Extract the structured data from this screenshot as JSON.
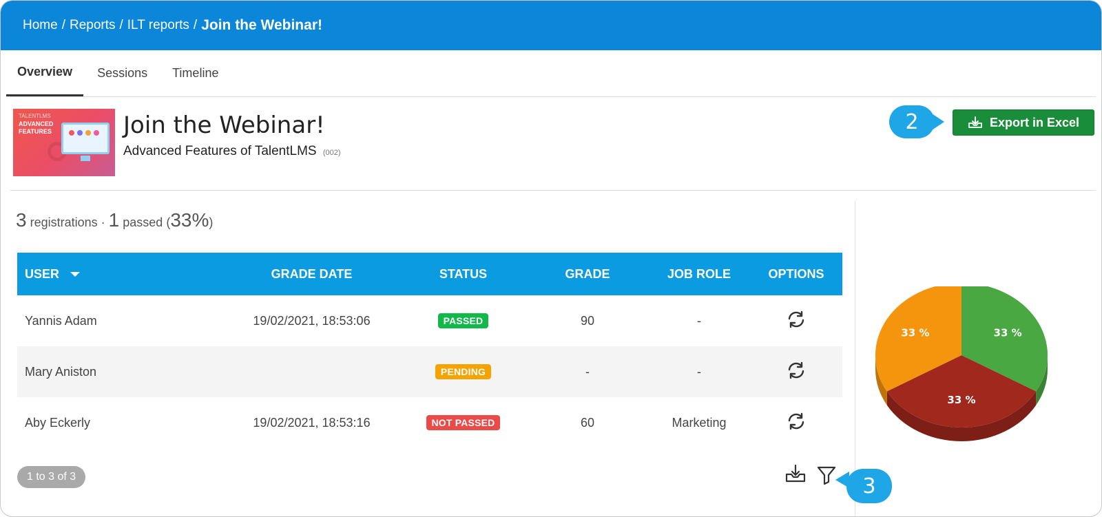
{
  "breadcrumb": {
    "items": [
      "Home",
      "Reports",
      "ILT reports"
    ],
    "separator": "/",
    "current": "Join the Webinar!"
  },
  "tabs": [
    {
      "label": "Overview",
      "active": true
    },
    {
      "label": "Sessions",
      "active": false
    },
    {
      "label": "Timeline",
      "active": false
    }
  ],
  "course": {
    "thumbnail": {
      "brand": "TALENTLMS",
      "line1": "ADVANCED",
      "line2": "FEATURES"
    },
    "title": "Join the Webinar!",
    "subtitle": "Advanced Features of TalentLMS",
    "code": "(002)"
  },
  "export": {
    "label": "Export in Excel",
    "icon": "download-tray-icon"
  },
  "callouts": {
    "export": "2",
    "filter": "3"
  },
  "summary": {
    "registrations_count": "3",
    "registrations_label": "registrations",
    "dot": "·",
    "passed_count": "1",
    "passed_label": "passed",
    "percent": "33%"
  },
  "table": {
    "headers": {
      "user": "USER",
      "grade_date": "GRADE DATE",
      "status": "STATUS",
      "grade": "GRADE",
      "job_role": "JOB ROLE",
      "options": "OPTIONS"
    },
    "rows": [
      {
        "user": "Yannis Adam",
        "grade_date": "19/02/2021, 18:53:06",
        "status": "PASSED",
        "grade": "90",
        "job_role": "-"
      },
      {
        "user": "Mary Aniston",
        "grade_date": "",
        "status": "PENDING",
        "grade": "-",
        "job_role": "-"
      },
      {
        "user": "Aby Eckerly",
        "grade_date": "19/02/2021, 18:53:16",
        "status": "NOT PASSED",
        "grade": "60",
        "job_role": "Marketing"
      }
    ]
  },
  "pagination": {
    "label": "1 to 3 of 3"
  },
  "colors": {
    "header": "#0b86d8",
    "table_header": "#0b9be0",
    "export_button": "#1a8d3a",
    "passed": "#12b84a",
    "pending": "#f5a300",
    "not_passed": "#ea4b48",
    "callout": "#1fa6e6"
  },
  "chart_data": {
    "type": "pie",
    "slices": [
      {
        "label": "33 %",
        "value": 33.3,
        "color": "#4aa843"
      },
      {
        "label": "33 %",
        "value": 33.3,
        "color": "#a0281d"
      },
      {
        "label": "33 %",
        "value": 33.3,
        "color": "#f5940d"
      }
    ]
  }
}
